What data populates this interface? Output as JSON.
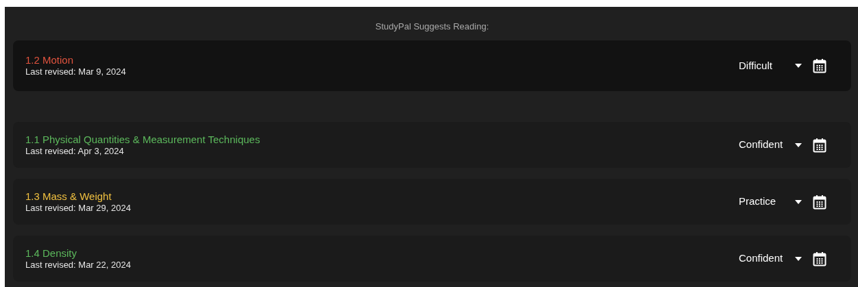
{
  "heading": "StudyPal Suggests Reading:",
  "suggested": {
    "title": "1.2 Motion",
    "color": "#e0533e",
    "revised": "Last revised: Mar 9, 2024",
    "rating": "Difficult"
  },
  "topics": [
    {
      "title": "1.1 Physical Quantities & Measurement Techniques",
      "color": "#5cb85c",
      "revised": "Last revised: Apr 3, 2024",
      "rating": "Confident"
    },
    {
      "title": "1.3 Mass & Weight",
      "color": "#f0c040",
      "revised": "Last revised: Mar 29, 2024",
      "rating": "Practice"
    },
    {
      "title": "1.4 Density",
      "color": "#5cb85c",
      "revised": "Last revised: Mar 22, 2024",
      "rating": "Confident"
    }
  ]
}
